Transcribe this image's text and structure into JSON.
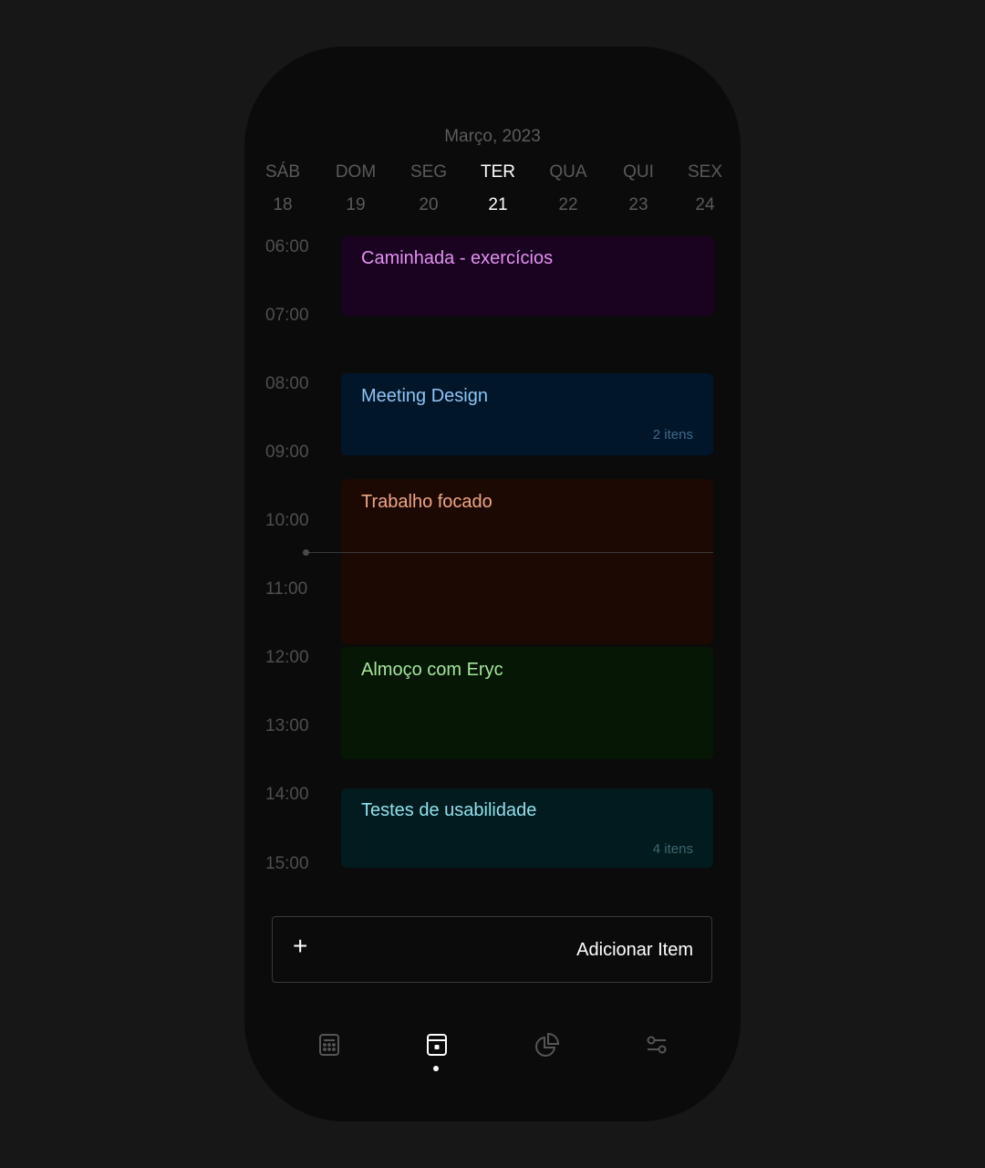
{
  "header": {
    "month_label": "Março, 2023"
  },
  "week": {
    "days": [
      {
        "name": "SÁB",
        "num": "18"
      },
      {
        "name": "DOM",
        "num": "19"
      },
      {
        "name": "SEG",
        "num": "20"
      },
      {
        "name": "TER",
        "num": "21"
      },
      {
        "name": "QUA",
        "num": "22"
      },
      {
        "name": "QUI",
        "num": "23"
      },
      {
        "name": "SEX",
        "num": "24"
      }
    ],
    "selected": "TER"
  },
  "timeline": {
    "hours": [
      "06:00",
      "07:00",
      "08:00",
      "09:00",
      "10:00",
      "11:00",
      "12:00",
      "13:00",
      "14:00",
      "15:00"
    ]
  },
  "events": [
    {
      "title": "Caminhada - exercícios",
      "count": "",
      "bg": "#1a0320",
      "color": "#e391f2"
    },
    {
      "title": "Meeting Design",
      "count": "2 itens",
      "bg": "#011628",
      "color": "#8ec4f5",
      "count_color": "#3f6a8e"
    },
    {
      "title": "Trabalho focado",
      "count": "",
      "bg": "#1c0903",
      "color": "#f0a585"
    },
    {
      "title": "Almoço com Eryc",
      "count": "",
      "bg": "#071705",
      "color": "#a3e69a"
    },
    {
      "title": "Testes de usabilidade",
      "count": "4 itens",
      "bg": "#021b1e",
      "color": "#8ee0eb",
      "count_color": "#3a6a70"
    }
  ],
  "add_button": {
    "plus": "+",
    "label": "Adicionar Item"
  },
  "bottom_nav": {
    "items": [
      {
        "icon": "calculator-icon",
        "active": false
      },
      {
        "icon": "calendar-day-icon",
        "active": true
      },
      {
        "icon": "pie-chart-icon",
        "active": false
      },
      {
        "icon": "settings-sliders-icon",
        "active": false
      }
    ]
  }
}
